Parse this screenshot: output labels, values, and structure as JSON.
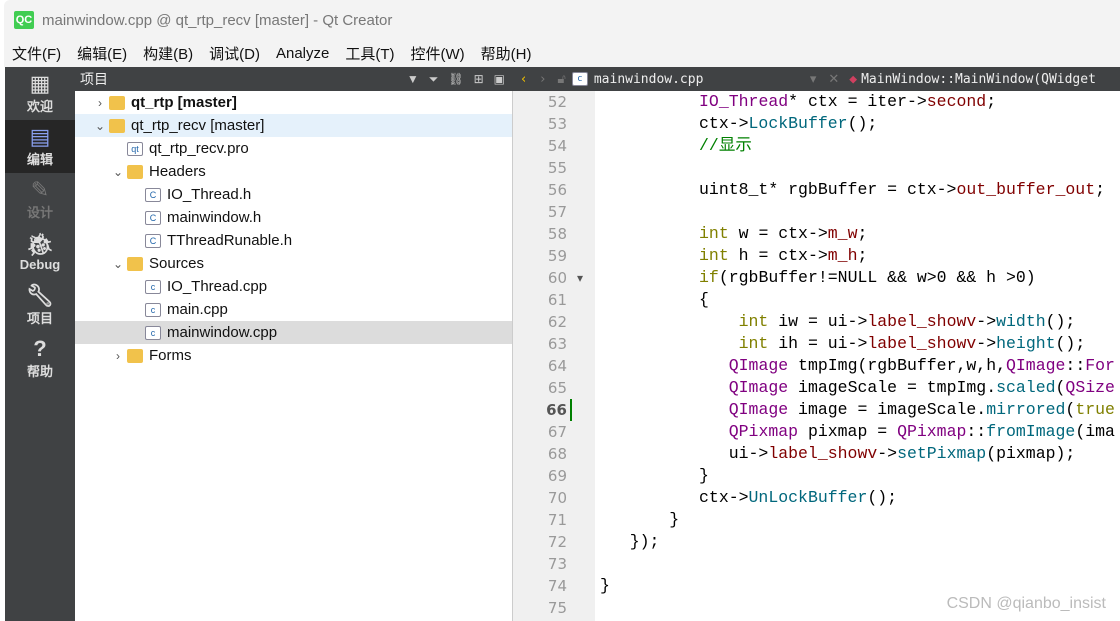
{
  "window": {
    "title": "mainwindow.cpp @ qt_rtp_recv [master] - Qt Creator",
    "logo": "QC"
  },
  "menu": [
    "文件(F)",
    "编辑(E)",
    "构建(B)",
    "调试(D)",
    "Analyze",
    "工具(T)",
    "控件(W)",
    "帮助(H)"
  ],
  "modes": [
    {
      "label": "欢迎",
      "icon": "grid-icon"
    },
    {
      "label": "编辑",
      "icon": "edit-icon",
      "selected": true
    },
    {
      "label": "设计",
      "icon": "pencil-icon",
      "disabled": true
    },
    {
      "label": "Debug",
      "icon": "bug-icon"
    },
    {
      "label": "项目",
      "icon": "wrench-icon"
    },
    {
      "label": "帮助",
      "icon": "help-icon"
    }
  ],
  "project_panel": {
    "title": "项目"
  },
  "tree": [
    {
      "label": "qt_rtp [master]",
      "depth": 0,
      "arrow": "›",
      "type": "project",
      "bold": true
    },
    {
      "label": "qt_rtp_recv [master]",
      "depth": 0,
      "arrow": "⌄",
      "type": "project",
      "selected": true
    },
    {
      "label": "qt_rtp_recv.pro",
      "depth": 1,
      "arrow": "",
      "type": "pro"
    },
    {
      "label": "Headers",
      "depth": 1,
      "arrow": "⌄",
      "type": "folder"
    },
    {
      "label": "IO_Thread.h",
      "depth": 2,
      "arrow": "",
      "type": "h"
    },
    {
      "label": "mainwindow.h",
      "depth": 2,
      "arrow": "",
      "type": "h"
    },
    {
      "label": "TThreadRunable.h",
      "depth": 2,
      "arrow": "",
      "type": "h"
    },
    {
      "label": "Sources",
      "depth": 1,
      "arrow": "⌄",
      "type": "folder"
    },
    {
      "label": "IO_Thread.cpp",
      "depth": 2,
      "arrow": "",
      "type": "cpp"
    },
    {
      "label": "main.cpp",
      "depth": 2,
      "arrow": "",
      "type": "cpp"
    },
    {
      "label": "mainwindow.cpp",
      "depth": 2,
      "arrow": "",
      "type": "cpp",
      "current": true
    },
    {
      "label": "Forms",
      "depth": 1,
      "arrow": "›",
      "type": "folder"
    }
  ],
  "editor": {
    "file": "mainwindow.cpp",
    "symbol": "MainWindow::MainWindow(QWidget",
    "current_line": 66,
    "lines": [
      {
        "n": 52,
        "t": [
          [
            "",
            "          "
          ],
          [
            "t",
            "IO_Thread"
          ],
          [
            "",
            "* ctx = iter->"
          ],
          [
            "m",
            "second"
          ],
          [
            "",
            ";"
          ]
        ]
      },
      {
        "n": 53,
        "t": [
          [
            "",
            "          ctx->"
          ],
          [
            "f",
            "LockBuffer"
          ],
          [
            "",
            "();"
          ]
        ]
      },
      {
        "n": 54,
        "t": [
          [
            "",
            "          "
          ],
          [
            "c",
            "//显示"
          ]
        ]
      },
      {
        "n": 55,
        "t": []
      },
      {
        "n": 56,
        "t": [
          [
            "",
            "          uint8_t* rgbBuffer = ctx->"
          ],
          [
            "m",
            "out_buffer_out"
          ],
          [
            "",
            ";"
          ]
        ]
      },
      {
        "n": 57,
        "t": []
      },
      {
        "n": 58,
        "t": [
          [
            "",
            "          "
          ],
          [
            "k",
            "int"
          ],
          [
            "",
            " w = ctx->"
          ],
          [
            "m",
            "m_w"
          ],
          [
            "",
            ";"
          ]
        ]
      },
      {
        "n": 59,
        "t": [
          [
            "",
            "          "
          ],
          [
            "k",
            "int"
          ],
          [
            "",
            " h = ctx->"
          ],
          [
            "m",
            "m_h"
          ],
          [
            "",
            ";"
          ]
        ]
      },
      {
        "n": 60,
        "t": [
          [
            "",
            "          "
          ],
          [
            "k",
            "if"
          ],
          [
            "",
            "(rgbBuffer!=NULL && w>0 && h >0)"
          ]
        ],
        "fold": true
      },
      {
        "n": 61,
        "t": [
          [
            "",
            "          {"
          ]
        ]
      },
      {
        "n": 62,
        "t": [
          [
            "",
            "              "
          ],
          [
            "k",
            "int"
          ],
          [
            "",
            " iw = ui->"
          ],
          [
            "m",
            "label_showv"
          ],
          [
            "",
            "->"
          ],
          [
            "f",
            "width"
          ],
          [
            "",
            "();"
          ]
        ]
      },
      {
        "n": 63,
        "t": [
          [
            "",
            "              "
          ],
          [
            "k",
            "int"
          ],
          [
            "",
            " ih = ui->"
          ],
          [
            "m",
            "label_showv"
          ],
          [
            "",
            "->"
          ],
          [
            "f",
            "height"
          ],
          [
            "",
            "();"
          ]
        ]
      },
      {
        "n": 64,
        "t": [
          [
            "",
            "             "
          ],
          [
            "t",
            "QImage"
          ],
          [
            "",
            " tmpImg(rgbBuffer,w,h,"
          ],
          [
            "t",
            "QImage"
          ],
          [
            "",
            "::"
          ],
          [
            "t",
            "For"
          ]
        ]
      },
      {
        "n": 65,
        "t": [
          [
            "",
            "             "
          ],
          [
            "t",
            "QImage"
          ],
          [
            "",
            " imageScale = tmpImg."
          ],
          [
            "f",
            "scaled"
          ],
          [
            "",
            "("
          ],
          [
            "t",
            "QSize"
          ]
        ]
      },
      {
        "n": 66,
        "t": [
          [
            "",
            "             "
          ],
          [
            "t",
            "QImage"
          ],
          [
            "",
            " image = imageScale."
          ],
          [
            "f",
            "mirrored"
          ],
          [
            "",
            "("
          ],
          [
            "k",
            "true"
          ]
        ]
      },
      {
        "n": 67,
        "t": [
          [
            "",
            "             "
          ],
          [
            "t",
            "QPixmap"
          ],
          [
            "",
            " pixmap = "
          ],
          [
            "t",
            "QPixmap"
          ],
          [
            "",
            "::"
          ],
          [
            "f",
            "fromImage"
          ],
          [
            "",
            "(ima"
          ]
        ]
      },
      {
        "n": 68,
        "t": [
          [
            "",
            "             ui->"
          ],
          [
            "m",
            "label_showv"
          ],
          [
            "",
            "->"
          ],
          [
            "f",
            "setPixmap"
          ],
          [
            "",
            "(pixmap);"
          ]
        ]
      },
      {
        "n": 69,
        "t": [
          [
            "",
            "          }"
          ]
        ]
      },
      {
        "n": 70,
        "t": [
          [
            "",
            "          ctx->"
          ],
          [
            "f",
            "UnLockBuffer"
          ],
          [
            "",
            "();"
          ]
        ]
      },
      {
        "n": 71,
        "t": [
          [
            "",
            "       }"
          ]
        ]
      },
      {
        "n": 72,
        "t": [
          [
            "",
            "   });"
          ]
        ]
      },
      {
        "n": 73,
        "t": []
      },
      {
        "n": 74,
        "t": [
          [
            "",
            "}"
          ]
        ]
      },
      {
        "n": 75,
        "t": []
      }
    ]
  },
  "watermark": "CSDN @qianbo_insist"
}
